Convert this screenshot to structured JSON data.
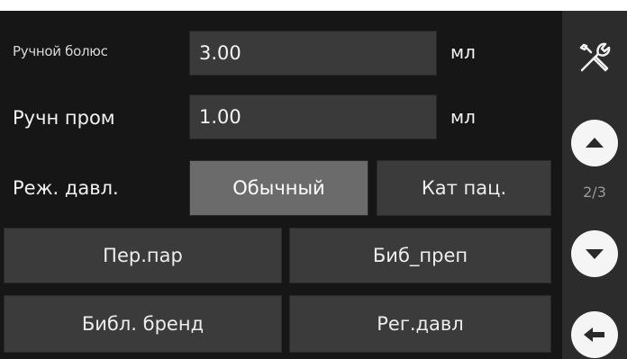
{
  "rows": {
    "manual_bolus": {
      "label": "Ручной болюс",
      "value": "3.00",
      "unit": "мл"
    },
    "manual_flush": {
      "label": "Ручн пром",
      "value": "1.00",
      "unit": "мл"
    },
    "pressure_mode": {
      "label": "Реж. давл.",
      "option_normal": "Обычный",
      "option_catheter": "Кат пац."
    }
  },
  "buttons": {
    "transfer_params": "Пер.пар",
    "drug_library": "Биб_преп",
    "brand_library": "Библ. бренд",
    "pressure_reg": "Рег.давл"
  },
  "side": {
    "page_indicator": "2/3",
    "icons": [
      "wrench-screwdriver-icon",
      "arrow-up-icon",
      "arrow-down-icon",
      "back-arrow-icon"
    ]
  },
  "colors": {
    "background": "#161616",
    "field": "#3a3a3a",
    "button": "#3b3b3b",
    "button_active": "#6b6b6b",
    "sidebar": "#2c2c2c"
  }
}
